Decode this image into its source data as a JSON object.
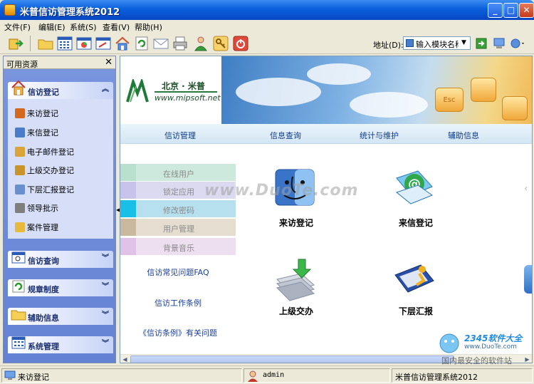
{
  "window": {
    "title": "米普信访管理系统2012",
    "minimize": "_",
    "maximize": "□",
    "close": "✕"
  },
  "menu": [
    "文件(F)",
    "编辑(E)",
    "系统(S)",
    "查看(V)",
    "帮助(H)"
  ],
  "toolbar": {
    "address_label": "地址(D):",
    "address_value": "输入模块名称"
  },
  "left_panel": {
    "title": "可用资源",
    "close": "✕",
    "groups": [
      {
        "label": "信访登记",
        "icon": "house-icon",
        "expanded": true
      },
      {
        "label": "信访查询",
        "icon": "search-window-icon",
        "expanded": false
      },
      {
        "label": "规章制度",
        "icon": "refresh-icon",
        "expanded": false
      },
      {
        "label": "辅助信息",
        "icon": "folder-icon",
        "expanded": false
      },
      {
        "label": "系统管理",
        "icon": "grid-icon",
        "expanded": false
      }
    ],
    "items": [
      {
        "label": "来访登记",
        "icon": "visitor-icon",
        "color": "#d2691e"
      },
      {
        "label": "来信登记",
        "icon": "letter-search-icon",
        "color": "#4a7cc9"
      },
      {
        "label": "电子邮件登记",
        "icon": "mail-icon",
        "color": "#d9a43a"
      },
      {
        "label": "上级交办登记",
        "icon": "clipboard-icon",
        "color": "#c9952a"
      },
      {
        "label": "下层汇报登记",
        "icon": "report-icon",
        "color": "#6a8fd0"
      },
      {
        "label": "领导批示",
        "icon": "memo-icon",
        "color": "#7f7f7f"
      },
      {
        "label": "案件管理",
        "icon": "folder-open-icon",
        "color": "#e7b93c"
      }
    ]
  },
  "banner": {
    "brand": "北京 · 米普",
    "url": "www.mipsoft.net",
    "keycap": "Esc"
  },
  "nav": [
    "信访管理",
    "信息查询",
    "统计与维护",
    "辅助信息"
  ],
  "side_menu": [
    {
      "label": "在线用户",
      "color": "#cde8dc"
    },
    {
      "label": "锁定应用",
      "color": "#dcdaf0"
    },
    {
      "label": "修改密码",
      "color": "#b7e0ef"
    },
    {
      "label": "用户管理",
      "color": "#e5ddcf"
    },
    {
      "label": "背景音乐",
      "color": "#eedff0"
    }
  ],
  "side_accents": [
    "#b9dfce",
    "#c7c3ea",
    "#19bfe6",
    "#c9b79e",
    "#e0c2e8"
  ],
  "side_links": [
    "信访常见问题FAQ",
    "信访工作条例",
    "《信访条例》有关问题"
  ],
  "tiles": [
    {
      "label": "来访登记",
      "icon": "finder-face-icon"
    },
    {
      "label": "来信登记",
      "icon": "at-sign-icon"
    },
    {
      "label": "上级交办",
      "icon": "download-arrow-icon"
    },
    {
      "label": "下层汇报",
      "icon": "presenter-icon"
    }
  ],
  "watermark": "www.DuoTe.com",
  "status": {
    "module": "来访登记",
    "user": "admin",
    "app": "米普信访管理系统2012"
  },
  "corner_watermark": {
    "line1": "2345软件大全",
    "line2": "www.DuoTe.com",
    "line3": "国内最安全的软件站"
  }
}
